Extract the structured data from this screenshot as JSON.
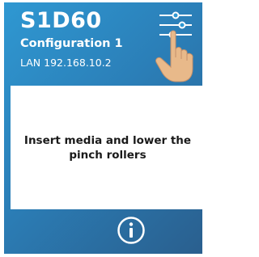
{
  "device": {
    "model": "S1D60",
    "configuration": "Configuration 1",
    "connection": "LAN 192.168.10.2"
  },
  "message": "Insert media and lower the pinch rollers",
  "icons": {
    "settings": "sliders-icon",
    "hand": "pointing-hand-icon",
    "info": "info-icon"
  },
  "colors": {
    "background_top": "#2f98d2",
    "background_bottom": "#2a5f8e",
    "text": "#ffffff",
    "panel": "#ffffff"
  }
}
